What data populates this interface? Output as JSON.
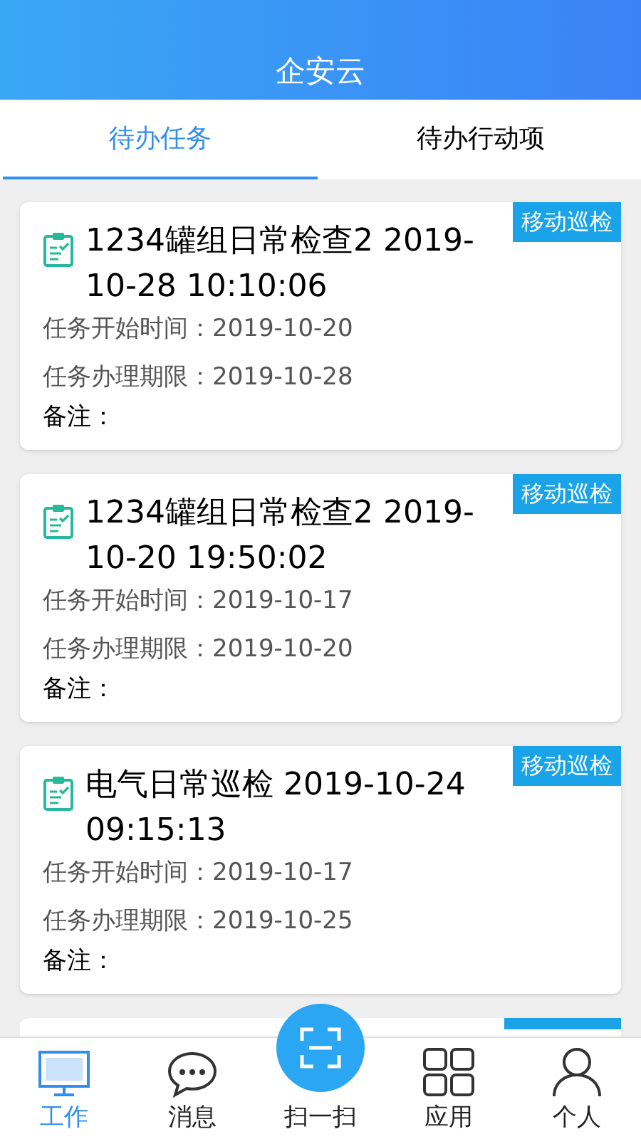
{
  "header": {
    "title": "企安云"
  },
  "tabs": [
    {
      "label": "待办任务",
      "selected": true
    },
    {
      "label": "待办行动项",
      "selected": false
    }
  ],
  "tasks": [
    {
      "title": "1234罐组日常检查2 2019-10-28 10:10:06",
      "tag": "移动巡检",
      "start_label": "任务开始时间：",
      "start": "2019-10-20",
      "deadline_label": "任务办理期限：",
      "deadline": "2019-10-28",
      "note_label": "备注："
    },
    {
      "title": "1234罐组日常检查2 2019-10-20 19:50:02",
      "tag": "移动巡检",
      "start_label": "任务开始时间：",
      "start": "2019-10-17",
      "deadline_label": "任务办理期限：",
      "deadline": "2019-10-20",
      "note_label": "备注："
    },
    {
      "title": "电气日常巡检 2019-10-24 09:15:13",
      "tag": "移动巡检",
      "start_label": "任务开始时间：",
      "start": "2019-10-17",
      "deadline_label": "任务办理期限：",
      "deadline": "2019-10-25",
      "note_label": "备注："
    }
  ],
  "nav": [
    {
      "kind": "monitor",
      "label": "工作",
      "selected": true
    },
    {
      "kind": "chat",
      "label": "消息",
      "selected": false
    },
    {
      "kind": "scan",
      "label": "扫一扫",
      "selected": false
    },
    {
      "kind": "grid",
      "label": "应用",
      "selected": false
    },
    {
      "kind": "person",
      "label": "个人",
      "selected": false
    }
  ]
}
